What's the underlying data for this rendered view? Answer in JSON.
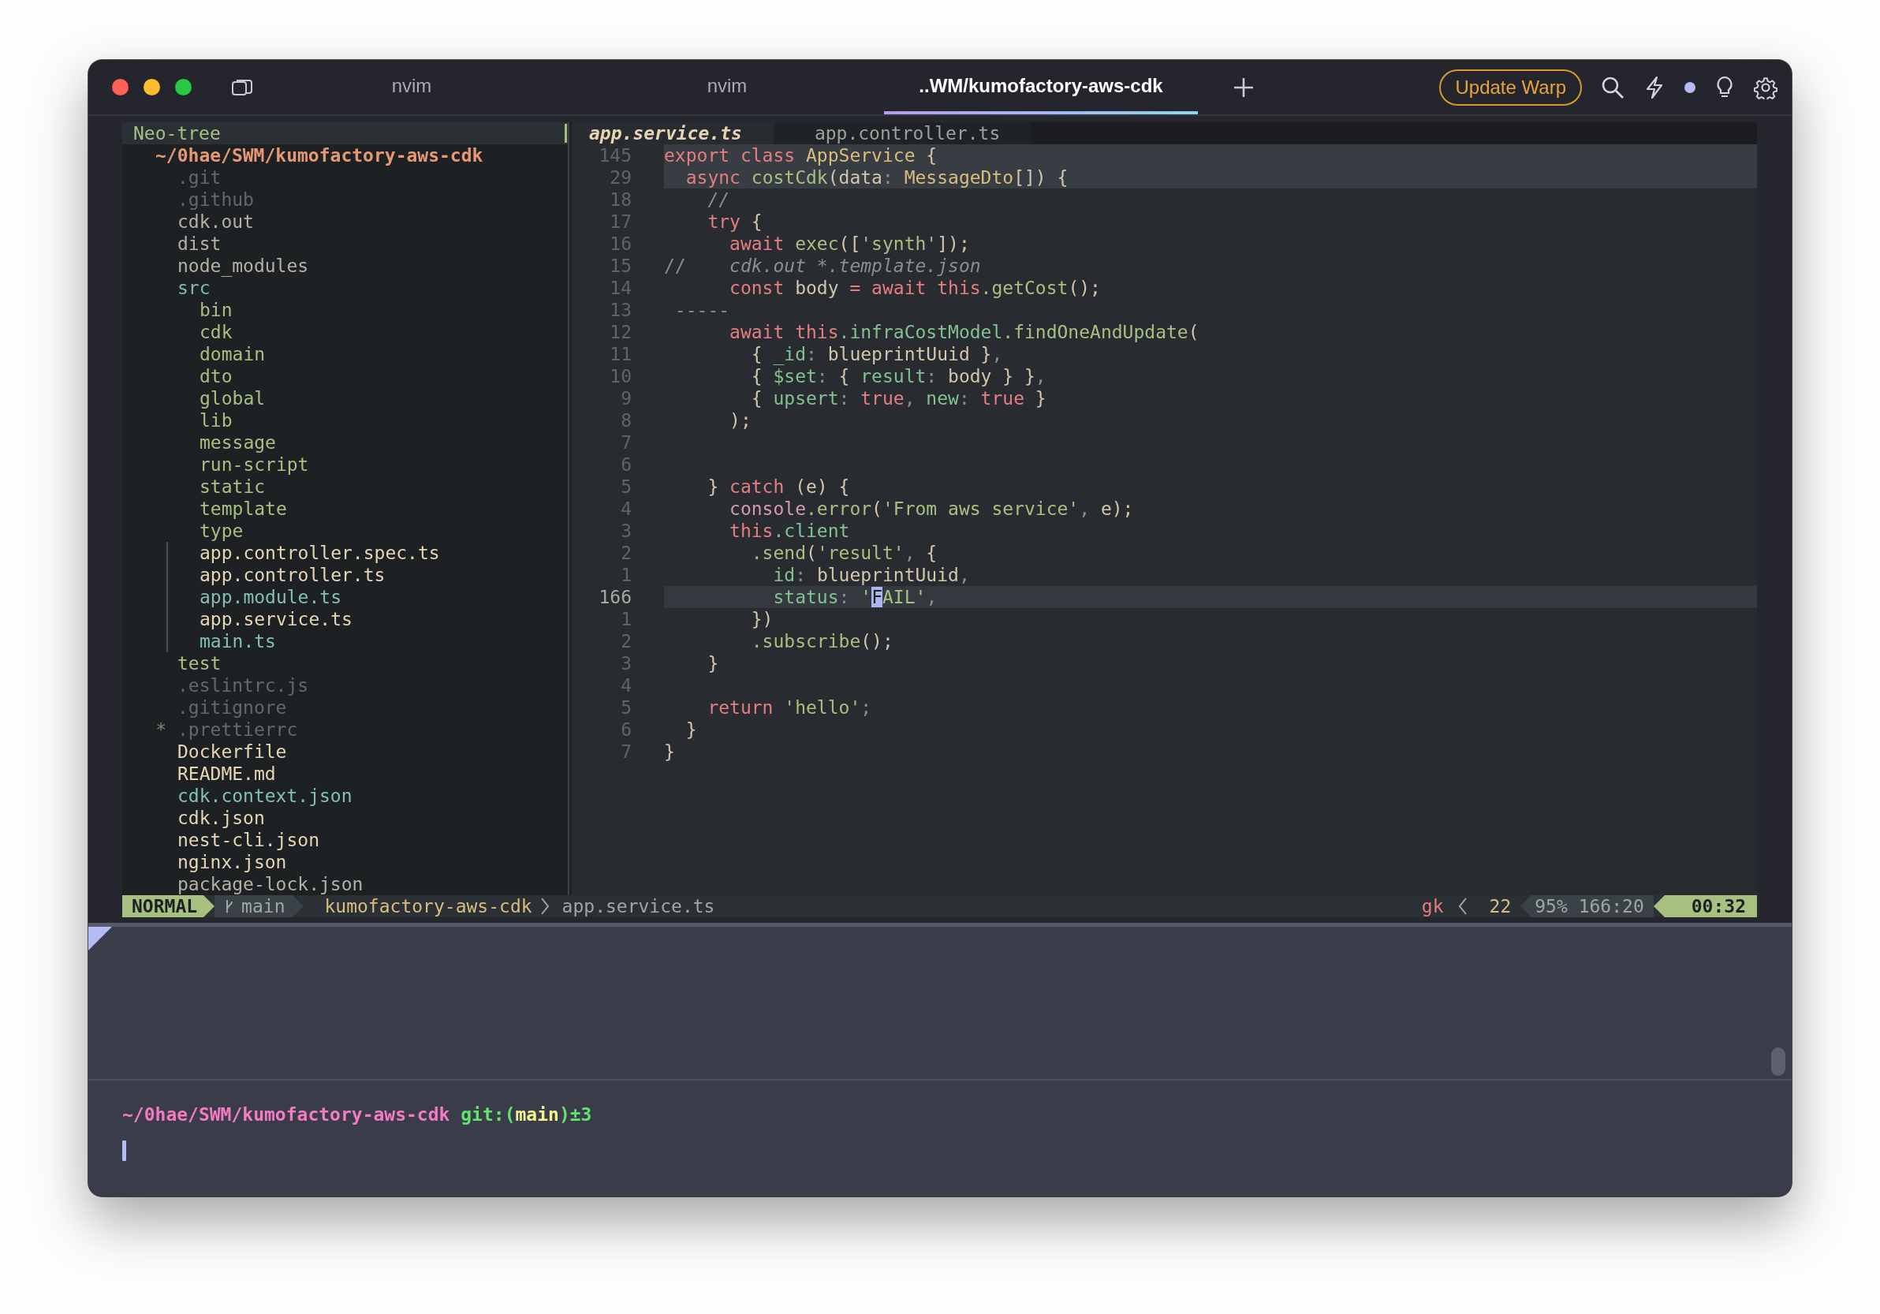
{
  "window": {
    "tabs": [
      {
        "title": "nvim",
        "selected": false
      },
      {
        "title": "nvim",
        "selected": false
      },
      {
        "title": "..WM/kumofactory-aws-cdk",
        "selected": true
      }
    ],
    "update_button": "Update Warp"
  },
  "tree": {
    "title": "Neo-tree",
    "root": "~/0hae/SWM/kumofactory-aws-cdk",
    "items": [
      {
        "name": ".git",
        "kind": "dotfile"
      },
      {
        "name": ".github",
        "kind": "dotfile"
      },
      {
        "name": "cdk.out",
        "kind": "ignored"
      },
      {
        "name": "dist",
        "kind": "ignored"
      },
      {
        "name": "node_modules",
        "kind": "ignored"
      },
      {
        "name": "src",
        "kind": "changed-folder",
        "children": [
          {
            "name": "bin",
            "kind": "folder"
          },
          {
            "name": "cdk",
            "kind": "folder"
          },
          {
            "name": "domain",
            "kind": "folder"
          },
          {
            "name": "dto",
            "kind": "folder"
          },
          {
            "name": "global",
            "kind": "folder"
          },
          {
            "name": "lib",
            "kind": "folder"
          },
          {
            "name": "message",
            "kind": "folder"
          },
          {
            "name": "run-script",
            "kind": "folder"
          },
          {
            "name": "static",
            "kind": "folder"
          },
          {
            "name": "template",
            "kind": "folder"
          },
          {
            "name": "type",
            "kind": "folder"
          },
          {
            "name": "app.controller.spec.ts",
            "kind": "file"
          },
          {
            "name": "app.controller.ts",
            "kind": "file"
          },
          {
            "name": "app.module.ts",
            "kind": "changed-file"
          },
          {
            "name": "app.service.ts",
            "kind": "file"
          },
          {
            "name": "main.ts",
            "kind": "changed-file"
          }
        ]
      },
      {
        "name": "test",
        "kind": "folder"
      },
      {
        "name": ".eslintrc.js",
        "kind": "dotfile"
      },
      {
        "name": ".gitignore",
        "kind": "dotfile"
      },
      {
        "name": ".prettierrc",
        "kind": "dotfile",
        "marker": "*"
      },
      {
        "name": "Dockerfile",
        "kind": "file"
      },
      {
        "name": "README.md",
        "kind": "file"
      },
      {
        "name": "cdk.context.json",
        "kind": "changed-file"
      },
      {
        "name": "cdk.json",
        "kind": "file"
      },
      {
        "name": "nest-cli.json",
        "kind": "file"
      },
      {
        "name": "nginx.json",
        "kind": "file"
      },
      {
        "name": "package-lock.json",
        "kind": "ignored"
      }
    ]
  },
  "editor": {
    "tabs": [
      {
        "label": "app.service.ts",
        "selected": true
      },
      {
        "label": "app.controller.ts",
        "selected": false
      }
    ],
    "lines": [
      {
        "number": "145",
        "sticky": true,
        "current": false,
        "tokens": [
          {
            "kind": "kw",
            "text": "export class "
          },
          {
            "kind": "type",
            "text": "AppService"
          },
          {
            "kind": "plain",
            "text": " {"
          }
        ]
      },
      {
        "number": "29",
        "sticky": true,
        "current": false,
        "tokens": [
          {
            "kind": "kw",
            "text": "  async "
          },
          {
            "kind": "fn",
            "text": "costCdk"
          },
          {
            "kind": "plain",
            "text": "(data"
          },
          {
            "kind": "punct",
            "text": ": "
          },
          {
            "kind": "type",
            "text": "MessageDto"
          },
          {
            "kind": "plain",
            "text": "[]) {"
          }
        ]
      },
      {
        "number": "18",
        "sticky": false,
        "current": false,
        "tokens": [
          {
            "kind": "comment",
            "text": "    //"
          }
        ]
      },
      {
        "number": "17",
        "sticky": false,
        "current": false,
        "tokens": [
          {
            "kind": "kw",
            "text": "    try"
          },
          {
            "kind": "plain",
            "text": " {"
          }
        ]
      },
      {
        "number": "16",
        "sticky": false,
        "current": false,
        "tokens": [
          {
            "kind": "kw",
            "text": "      await "
          },
          {
            "kind": "fn",
            "text": "exec"
          },
          {
            "kind": "plain",
            "text": "(["
          },
          {
            "kind": "str",
            "text": "'synth'"
          },
          {
            "kind": "plain",
            "text": "]);"
          }
        ]
      },
      {
        "number": "15",
        "sticky": false,
        "current": false,
        "tokens": [
          {
            "kind": "punct",
            "text": "//    "
          },
          {
            "kind": "comment",
            "text": "cdk.out *.template.json"
          }
        ]
      },
      {
        "number": "14",
        "sticky": false,
        "current": false,
        "tokens": [
          {
            "kind": "kw",
            "text": "      const "
          },
          {
            "kind": "plain",
            "text": "body "
          },
          {
            "kind": "kw",
            "text": "= await this"
          },
          {
            "kind": "fn",
            "text": ".getCost"
          },
          {
            "kind": "plain",
            "text": "();"
          }
        ]
      },
      {
        "number": "13",
        "sticky": false,
        "current": false,
        "tokens": [
          {
            "kind": "punct",
            "text": " -----"
          }
        ]
      },
      {
        "number": "12",
        "sticky": false,
        "current": false,
        "tokens": [
          {
            "kind": "kw",
            "text": "      await this"
          },
          {
            "kind": "prop",
            "text": ".infraCostModel"
          },
          {
            "kind": "fn",
            "text": ".findOneAndUpdate"
          },
          {
            "kind": "plain",
            "text": "("
          }
        ]
      },
      {
        "number": "11",
        "sticky": false,
        "current": false,
        "tokens": [
          {
            "kind": "plain",
            "text": "        { "
          },
          {
            "kind": "prop",
            "text": "_id"
          },
          {
            "kind": "punct",
            "text": ": "
          },
          {
            "kind": "plain",
            "text": "blueprintUuid }"
          },
          {
            "kind": "punct",
            "text": ","
          }
        ]
      },
      {
        "number": "10",
        "sticky": false,
        "current": false,
        "tokens": [
          {
            "kind": "plain",
            "text": "        { "
          },
          {
            "kind": "prop",
            "text": "$set"
          },
          {
            "kind": "punct",
            "text": ": "
          },
          {
            "kind": "plain",
            "text": "{ "
          },
          {
            "kind": "prop",
            "text": "result"
          },
          {
            "kind": "punct",
            "text": ": "
          },
          {
            "kind": "plain",
            "text": "body } }"
          },
          {
            "kind": "punct",
            "text": ","
          }
        ]
      },
      {
        "number": "9",
        "sticky": false,
        "current": false,
        "tokens": [
          {
            "kind": "plain",
            "text": "        { "
          },
          {
            "kind": "prop",
            "text": "upsert"
          },
          {
            "kind": "punct",
            "text": ": "
          },
          {
            "kind": "kw",
            "text": "true"
          },
          {
            "kind": "punct",
            "text": ", "
          },
          {
            "kind": "prop",
            "text": "new"
          },
          {
            "kind": "punct",
            "text": ": "
          },
          {
            "kind": "kw",
            "text": "true"
          },
          {
            "kind": "plain",
            "text": " }"
          }
        ]
      },
      {
        "number": "8",
        "sticky": false,
        "current": false,
        "tokens": [
          {
            "kind": "plain",
            "text": "      );"
          }
        ]
      },
      {
        "number": "7",
        "sticky": false,
        "current": false
      },
      {
        "number": "6",
        "sticky": false,
        "current": false
      },
      {
        "number": "5",
        "sticky": false,
        "current": false,
        "tokens": [
          {
            "kind": "plain",
            "text": "    } "
          },
          {
            "kind": "kw",
            "text": "catch"
          },
          {
            "kind": "plain",
            "text": " (e) {"
          }
        ]
      },
      {
        "number": "4",
        "sticky": false,
        "current": false,
        "tokens": [
          {
            "kind": "obj",
            "text": "      console"
          },
          {
            "kind": "fn",
            "text": ".error"
          },
          {
            "kind": "plain",
            "text": "("
          },
          {
            "kind": "str",
            "text": "'From aws service'"
          },
          {
            "kind": "punct",
            "text": ", "
          },
          {
            "kind": "plain",
            "text": "e);"
          }
        ]
      },
      {
        "number": "3",
        "sticky": false,
        "current": false,
        "tokens": [
          {
            "kind": "kw",
            "text": "      this"
          },
          {
            "kind": "prop",
            "text": ".client"
          }
        ]
      },
      {
        "number": "2",
        "sticky": false,
        "current": false,
        "tokens": [
          {
            "kind": "fn",
            "text": "        .send"
          },
          {
            "kind": "plain",
            "text": "("
          },
          {
            "kind": "str",
            "text": "'result'"
          },
          {
            "kind": "punct",
            "text": ", "
          },
          {
            "kind": "plain",
            "text": "{"
          }
        ]
      },
      {
        "number": "1",
        "sticky": false,
        "current": false,
        "tokens": [
          {
            "kind": "prop",
            "text": "          id"
          },
          {
            "kind": "punct",
            "text": ": "
          },
          {
            "kind": "plain",
            "text": "blueprintUuid"
          },
          {
            "kind": "punct",
            "text": ","
          }
        ]
      },
      {
        "number": "166",
        "sticky": false,
        "current": true,
        "tokens": [
          {
            "kind": "prop",
            "text": "          status"
          },
          {
            "kind": "punct",
            "text": ": "
          },
          {
            "kind": "str",
            "text": "'"
          },
          {
            "kind": "cursor",
            "text": "F"
          },
          {
            "kind": "str",
            "text": "AIL'"
          },
          {
            "kind": "punct",
            "text": ","
          }
        ]
      },
      {
        "number": "1",
        "sticky": false,
        "current": false,
        "tokens": [
          {
            "kind": "plain",
            "text": "        })"
          }
        ]
      },
      {
        "number": "2",
        "sticky": false,
        "current": false,
        "tokens": [
          {
            "kind": "fn",
            "text": "        .subscribe"
          },
          {
            "kind": "plain",
            "text": "();"
          }
        ]
      },
      {
        "number": "3",
        "sticky": false,
        "current": false,
        "tokens": [
          {
            "kind": "plain",
            "text": "    }"
          }
        ]
      },
      {
        "number": "4",
        "sticky": false,
        "current": false
      },
      {
        "number": "5",
        "sticky": false,
        "current": false,
        "tokens": [
          {
            "kind": "kw",
            "text": "    return "
          },
          {
            "kind": "str",
            "text": "'hello'"
          },
          {
            "kind": "punct",
            "text": ";"
          }
        ]
      },
      {
        "number": "6",
        "sticky": false,
        "current": false,
        "tokens": [
          {
            "kind": "plain",
            "text": "  }"
          }
        ]
      },
      {
        "number": "7",
        "sticky": false,
        "current": false,
        "tokens": [
          {
            "kind": "plain",
            "text": "}"
          }
        ]
      }
    ]
  },
  "status_line": {
    "mode": "NORMAL",
    "branch": "main",
    "project": "kumofactory-aws-cdk",
    "file": "app.service.ts",
    "macro": "gk",
    "count": "22",
    "position": "95% 166:20",
    "time": "00:32"
  },
  "terminal": {
    "prompt": {
      "path": "~/0hae/SWM/kumofactory-aws-cdk",
      "git_label": "git:(",
      "branch": "main",
      "suffix": ")±3"
    }
  }
}
